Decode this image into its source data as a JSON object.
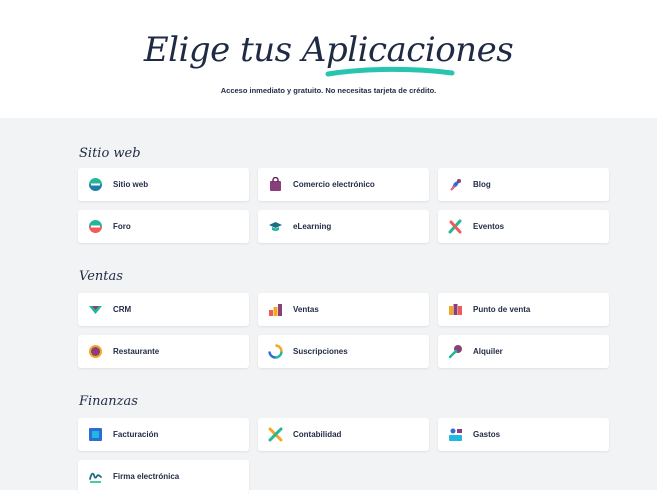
{
  "hero": {
    "title_part1": "Elige tus ",
    "title_part2": "Aplicaciones",
    "subtitle": "Acceso inmediato y gratuito. No necesitas tarjeta de crédito.",
    "underline_color": "#27c4b0"
  },
  "sections": [
    {
      "title": "Sitio web",
      "apps": [
        {
          "label": "Sitio web",
          "icon": "website-icon"
        },
        {
          "label": "Comercio electrónico",
          "icon": "ecommerce-icon"
        },
        {
          "label": "Blog",
          "icon": "blog-icon"
        },
        {
          "label": "Foro",
          "icon": "forum-icon"
        },
        {
          "label": "eLearning",
          "icon": "elearning-icon"
        },
        {
          "label": "Eventos",
          "icon": "events-icon"
        }
      ]
    },
    {
      "title": "Ventas",
      "apps": [
        {
          "label": "CRM",
          "icon": "crm-icon"
        },
        {
          "label": "Ventas",
          "icon": "sales-icon"
        },
        {
          "label": "Punto de venta",
          "icon": "point-of-sale-icon"
        },
        {
          "label": "Restaurante",
          "icon": "restaurant-icon"
        },
        {
          "label": "Suscripciones",
          "icon": "subscriptions-icon"
        },
        {
          "label": "Alquiler",
          "icon": "rental-icon"
        }
      ]
    },
    {
      "title": "Finanzas",
      "apps": [
        {
          "label": "Facturación",
          "icon": "invoicing-icon"
        },
        {
          "label": "Contabilidad",
          "icon": "accounting-icon"
        },
        {
          "label": "Gastos",
          "icon": "expenses-icon"
        },
        {
          "label": "Firma electrónica",
          "icon": "sign-icon"
        }
      ]
    }
  ]
}
